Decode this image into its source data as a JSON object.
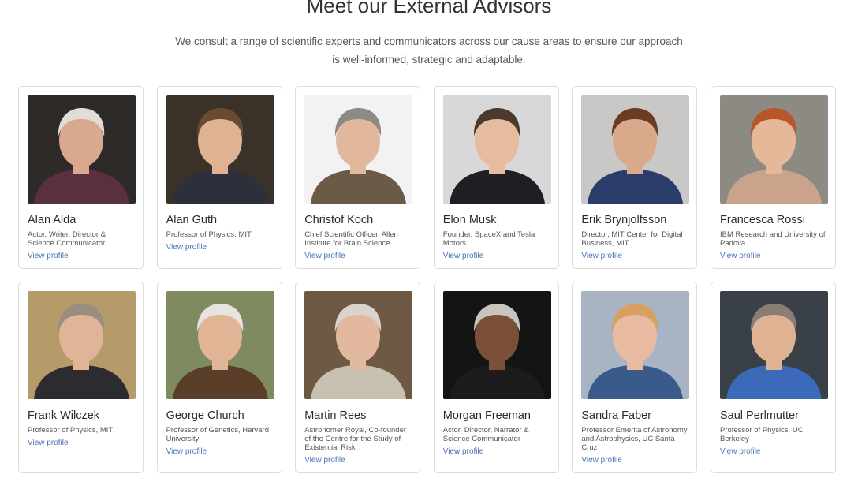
{
  "page": {
    "title": "Meet our External Advisors",
    "intro_line1": "We consult a range of scientific experts and communicators across our cause areas to ensure our approach",
    "intro_line2": "is well-informed, strategic and adaptable."
  },
  "advisors": [
    {
      "name": "Alan Alda",
      "role": "Actor, Writer, Director & Science Communicator",
      "link": "View profile",
      "bg": "#2e2a28",
      "skin": "#d9a88e",
      "hair": "#e0dcd6",
      "shirt": "#5a3040"
    },
    {
      "name": "Alan Guth",
      "role": "Professor of Physics, MIT",
      "link": "View profile",
      "bg": "#3a3128",
      "skin": "#e0b294",
      "hair": "#6b4a2e",
      "shirt": "#2d2f3a"
    },
    {
      "name": "Christof Koch",
      "role": "Chief Scientific Officer, Allen Institute for Brain Science",
      "link": "View profile",
      "bg": "#f2f2f2",
      "skin": "#e2b89c",
      "hair": "#8c8a86",
      "shirt": "#6b5a48"
    },
    {
      "name": "Elon Musk",
      "role": "Founder, SpaceX and Tesla Motors",
      "link": "View profile",
      "bg": "#d8d8d8",
      "skin": "#e6bca0",
      "hair": "#4a3a2c",
      "shirt": "#1e1e24"
    },
    {
      "name": "Erik Brynjolfsson",
      "role": "Director, MIT Center for Digital Business, MIT",
      "link": "View profile",
      "bg": "#c9c8c6",
      "skin": "#d9a98c",
      "hair": "#6a3c22",
      "shirt": "#2a3d6a"
    },
    {
      "name": "Francesca Rossi",
      "role": "IBM Research and University of Padova",
      "link": "View profile",
      "bg": "#8d8a84",
      "skin": "#e6b89a",
      "hair": "#b8552a",
      "shirt": "#c9a48a"
    },
    {
      "name": "Frank Wilczek",
      "role": "Professor of Physics, MIT",
      "link": "View profile",
      "bg": "#b59a6a",
      "skin": "#e0b496",
      "hair": "#9a8c7e",
      "shirt": "#2c2c30"
    },
    {
      "name": "George Church",
      "role": "Professor of Genetics, Harvard University",
      "link": "View profile",
      "bg": "#7f8a60",
      "skin": "#e2b496",
      "hair": "#e6e4e0",
      "shirt": "#5a3e2a"
    },
    {
      "name": "Martin Rees",
      "role": "Astronomer Royal, Co-founder of the Centre for the Study of Existential Risk",
      "link": "View profile",
      "bg": "#6e5a44",
      "skin": "#e2b99e",
      "hair": "#d8d4cc",
      "shirt": "#c8c0b0"
    },
    {
      "name": "Morgan Freeman",
      "role": "Actor, Director, Narrator & Science Communicator",
      "link": "View profile",
      "bg": "#141414",
      "skin": "#7a5038",
      "hair": "#c8c4be",
      "shirt": "#1c1c1c"
    },
    {
      "name": "Sandra Faber",
      "role": "Professor Emerita of Astronomy and Astrophysics, UC Santa Cruz",
      "link": "View profile",
      "bg": "#a8b4c4",
      "skin": "#e8baa0",
      "hair": "#d8a060",
      "shirt": "#3a5a8c"
    },
    {
      "name": "Saul Perlmutter",
      "role": "Professor of Physics, UC Berkeley",
      "link": "View profile",
      "bg": "#3a4048",
      "skin": "#e0b294",
      "hair": "#8a7e74",
      "shirt": "#3a6ab8"
    }
  ]
}
